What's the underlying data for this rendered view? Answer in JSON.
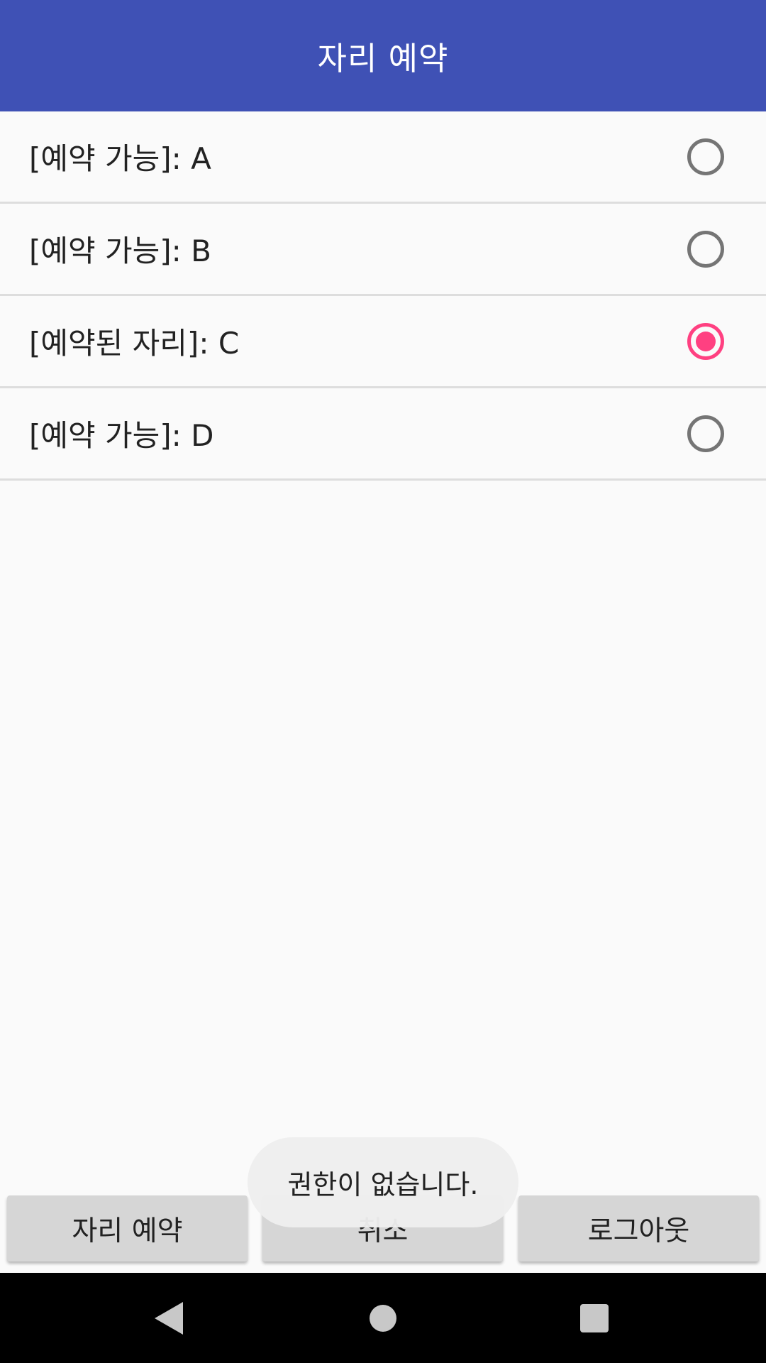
{
  "app_bar": {
    "title": "자리 예약",
    "background": "#3f51b5"
  },
  "seats": [
    {
      "label": "[예약 가능]: A",
      "checked": false
    },
    {
      "label": "[예약 가능]: B",
      "checked": false
    },
    {
      "label": "[예약된 자리]: C",
      "checked": true
    },
    {
      "label": "[예약 가능]: D",
      "checked": false
    }
  ],
  "accent_color": "#ff4081",
  "buttons": {
    "reserve_label": "자리 예약",
    "cancel_label": "취소",
    "logout_label": "로그아웃"
  },
  "toast": {
    "message": "권한이 없습니다."
  },
  "nav_bar": {
    "back_icon": "back-triangle-icon",
    "home_icon": "home-circle-icon",
    "recents_icon": "recents-square-icon"
  }
}
